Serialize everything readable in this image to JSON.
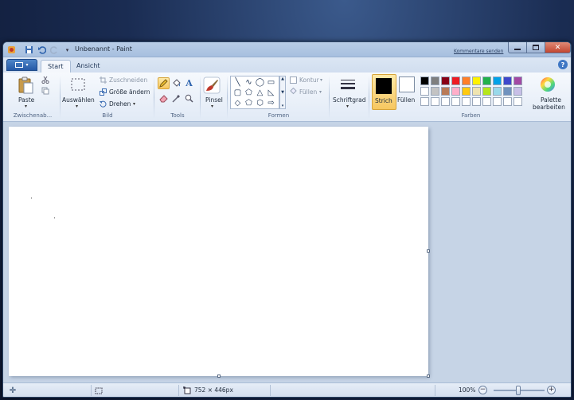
{
  "window": {
    "title": "Unbenannt - Paint",
    "feedback_link": "Kommentare senden"
  },
  "tabs": [
    {
      "label": "Start",
      "active": true
    },
    {
      "label": "Ansicht",
      "active": false
    }
  ],
  "clipboard": {
    "paste_label": "Paste",
    "group_label": "Zwischenab..."
  },
  "image": {
    "select_label": "Auswählen",
    "crop_label": "Zuschneiden",
    "resize_label": "Größe ändern",
    "rotate_label": "Drehen",
    "group_label": "Bild"
  },
  "tools": {
    "group_label": "Tools"
  },
  "brushes": {
    "label": "Pinsel"
  },
  "shapes": {
    "outline_label": "Kontur",
    "fill_label": "Füllen",
    "group_label": "Formen"
  },
  "size": {
    "label": "Schriftgrad"
  },
  "colors": {
    "color1_label": "Strich",
    "color2_label": "Füllen",
    "edit_label_line1": "Palette",
    "edit_label_line2": "bearbeiten",
    "group_label": "Farben",
    "color1": "#000000",
    "color2": "#ffffff",
    "palette_row1": [
      "#000000",
      "#7f7f7f",
      "#880015",
      "#ed1c24",
      "#ff7f27",
      "#fff200",
      "#22b14c",
      "#00a2e8",
      "#3f48cc",
      "#a349a4"
    ],
    "palette_row2": [
      "#ffffff",
      "#c3c3c3",
      "#b97a57",
      "#ffaec9",
      "#ffc90e",
      "#efe4b0",
      "#b5e61d",
      "#99d9ea",
      "#7092be",
      "#c8bfe7"
    ]
  },
  "status": {
    "canvas_size": "752 × 446px",
    "zoom": "100%"
  }
}
